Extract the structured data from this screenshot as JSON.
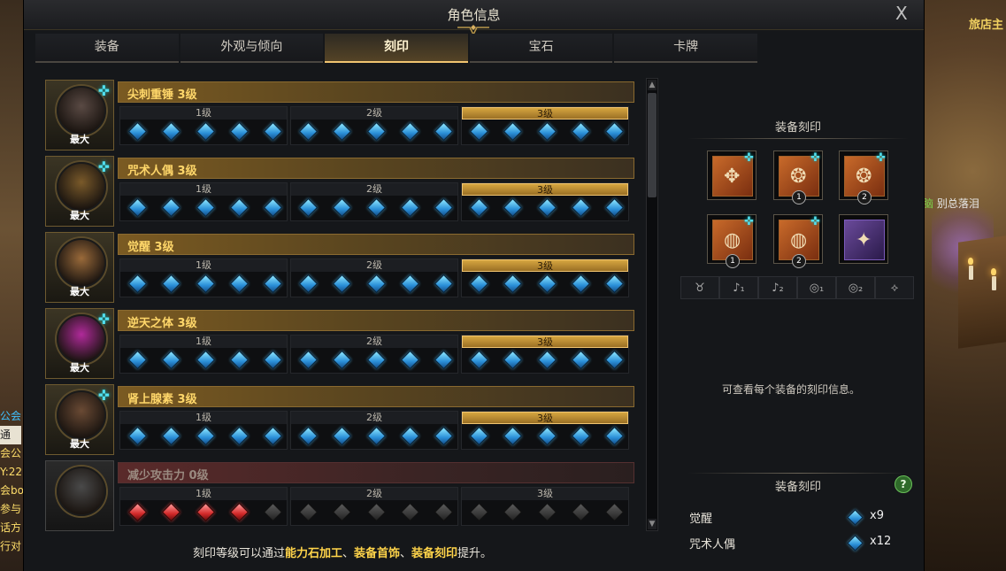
{
  "window": {
    "title": "角色信息",
    "close": "X"
  },
  "tabs": [
    {
      "label": "装备",
      "active": false
    },
    {
      "label": "外观与倾向",
      "active": false
    },
    {
      "label": "刻印",
      "active": true
    },
    {
      "label": "宝石",
      "active": false
    },
    {
      "label": "卡牌",
      "active": false
    }
  ],
  "engravings": [
    {
      "name": "尖刺重锤 3级",
      "badge": "最大",
      "levels": [
        "1级",
        "2级",
        "3级"
      ],
      "active_level": 3,
      "gems": "blue",
      "face": "#5a4a44",
      "spark": true
    },
    {
      "name": "咒术人偶 3级",
      "badge": "最大",
      "levels": [
        "1级",
        "2级",
        "3级"
      ],
      "active_level": 3,
      "gems": "blue",
      "face": "#7a5a2a",
      "spark": true
    },
    {
      "name": "觉醒 3级",
      "badge": "最大",
      "levels": [
        "1级",
        "2级",
        "3级"
      ],
      "active_level": 3,
      "gems": "blue",
      "face": "#9a6a3a",
      "spark": false
    },
    {
      "name": "逆天之体 3级",
      "badge": "最大",
      "levels": [
        "1级",
        "2级",
        "3级"
      ],
      "active_level": 3,
      "gems": "blue",
      "face": "#b02a9a",
      "spark": true
    },
    {
      "name": "肾上腺素 3级",
      "badge": "最大",
      "levels": [
        "1级",
        "2级",
        "3级"
      ],
      "active_level": 3,
      "gems": "blue",
      "face": "#6a4a34",
      "spark": true
    },
    {
      "name": "减少攻击力 0级",
      "badge": "",
      "levels": [
        "1级",
        "2级",
        "3级"
      ],
      "active_level": 0,
      "gems": "red",
      "face": "#4a4a4a",
      "spark": false
    }
  ],
  "footer": {
    "prefix": "刻印等级可以通过",
    "hl1": "能力石加工",
    "sep1": "、",
    "hl2": "装备首饰",
    "sep2": "、",
    "hl3": "装备刻印",
    "suffix": "提升。"
  },
  "right_panel": {
    "section1_title": "装备刻印",
    "slots": [
      {
        "icon": "necklace-icon",
        "glyph": "✥",
        "num": "",
        "spark": true,
        "purple": false
      },
      {
        "icon": "earring-icon",
        "glyph": "❂",
        "num": "1",
        "spark": true,
        "purple": false
      },
      {
        "icon": "earring-icon",
        "glyph": "❂",
        "num": "2",
        "spark": true,
        "purple": false
      },
      {
        "icon": "ring-icon",
        "glyph": "◍",
        "num": "1",
        "spark": true,
        "purple": false
      },
      {
        "icon": "ring-icon",
        "glyph": "◍",
        "num": "2",
        "spark": true,
        "purple": false
      },
      {
        "icon": "ability-stone-icon",
        "glyph": "✦",
        "num": "",
        "spark": false,
        "purple": true
      }
    ],
    "filter_icons": [
      {
        "icon": "necklace-filter-icon",
        "glyph": "♉"
      },
      {
        "icon": "earring1-filter-icon",
        "glyph": "♪₁"
      },
      {
        "icon": "earring2-filter-icon",
        "glyph": "♪₂"
      },
      {
        "icon": "ring1-filter-icon",
        "glyph": "◎₁"
      },
      {
        "icon": "ring2-filter-icon",
        "glyph": "◎₂"
      },
      {
        "icon": "stone-filter-icon",
        "glyph": "⟡"
      }
    ],
    "info": "可查看每个装备的刻印信息。",
    "section2_title": "装备刻印",
    "help": "?",
    "summary": [
      {
        "name": "觉醒",
        "count": "x9"
      },
      {
        "name": "咒术人偶",
        "count": "x12"
      }
    ]
  },
  "background": {
    "inn_label": "旅店主",
    "npc_hl": "脑",
    "npc_label": "别总落泪",
    "chat": [
      "公会",
      "通",
      "会公",
      "Y:22",
      "会bos",
      "参与",
      "话方",
      "行对"
    ]
  }
}
